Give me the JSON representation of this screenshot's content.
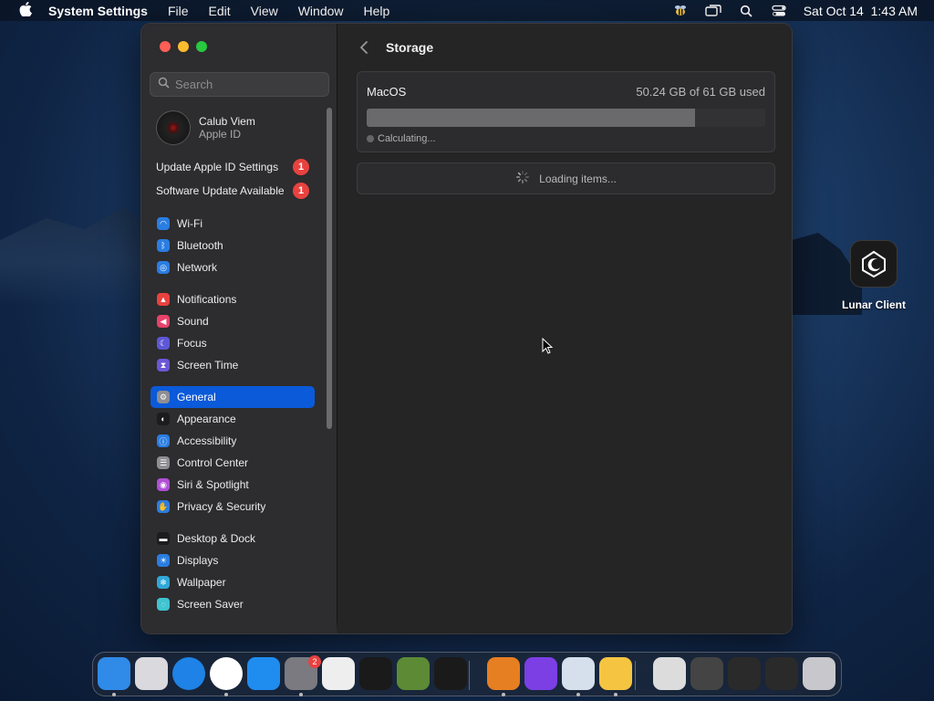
{
  "menubar": {
    "app_name": "System Settings",
    "menus": [
      "File",
      "Edit",
      "View",
      "Window",
      "Help"
    ],
    "clock": "Sat Oct 14  1:43 AM",
    "status_icons": [
      "bee-icon",
      "screen-mirror-icon",
      "spotlight-search-icon",
      "control-center-icon"
    ]
  },
  "window": {
    "search": {
      "placeholder": "Search",
      "value": ""
    },
    "account": {
      "name": "Calub Viem",
      "subtitle": "Apple ID"
    },
    "notices": [
      {
        "label": "Update Apple ID Settings",
        "badge": "1"
      },
      {
        "label": "Software Update Available",
        "badge": "1"
      }
    ],
    "sidebar_groups": [
      [
        {
          "label": "Wi-Fi",
          "icon": "wifi-icon",
          "color": "#2a7de1"
        },
        {
          "label": "Bluetooth",
          "icon": "bluetooth-icon",
          "color": "#2a7de1"
        },
        {
          "label": "Network",
          "icon": "globe-icon",
          "color": "#2a7de1"
        }
      ],
      [
        {
          "label": "Notifications",
          "icon": "bell-icon",
          "color": "#e8423f"
        },
        {
          "label": "Sound",
          "icon": "speaker-icon",
          "color": "#e8426a"
        },
        {
          "label": "Focus",
          "icon": "moon-icon",
          "color": "#5e57d6"
        },
        {
          "label": "Screen Time",
          "icon": "hourglass-icon",
          "color": "#6b57d6"
        }
      ],
      [
        {
          "label": "General",
          "icon": "gear-icon",
          "color": "#8e8e93",
          "selected": true
        },
        {
          "label": "Appearance",
          "icon": "appearance-icon",
          "color": "#1c1c1e"
        },
        {
          "label": "Accessibility",
          "icon": "accessibility-icon",
          "color": "#2a7de1"
        },
        {
          "label": "Control Center",
          "icon": "control-center-icon",
          "color": "#8e8e93"
        },
        {
          "label": "Siri & Spotlight",
          "icon": "siri-icon",
          "color": "#b04fd6"
        },
        {
          "label": "Privacy & Security",
          "icon": "hand-icon",
          "color": "#2a7de1"
        }
      ],
      [
        {
          "label": "Desktop & Dock",
          "icon": "dock-icon",
          "color": "#1c1c1e"
        },
        {
          "label": "Displays",
          "icon": "sun-icon",
          "color": "#2a7de1"
        },
        {
          "label": "Wallpaper",
          "icon": "wallpaper-icon",
          "color": "#2fa8d8"
        },
        {
          "label": "Screen Saver",
          "icon": "screensaver-icon",
          "color": "#3fc4d0"
        }
      ]
    ],
    "main": {
      "title": "Storage",
      "disk_name": "MacOS",
      "usage_text": "50.24 GB of 61 GB used",
      "usage_fraction": 0.8236,
      "status": "Calculating...",
      "loading_text": "Loading items..."
    }
  },
  "desktop": {
    "icon_label": "Lunar Client"
  },
  "dock": {
    "apps": [
      {
        "name": "finder-icon",
        "color": "#2f8ae8"
      },
      {
        "name": "launchpad-icon",
        "color": "#d9d9de"
      },
      {
        "name": "safari-icon",
        "color": "#1e82e6"
      },
      {
        "name": "chrome-icon",
        "color": "#ffffff"
      },
      {
        "name": "app-store-icon",
        "color": "#1f8cf0"
      },
      {
        "name": "system-settings-icon",
        "color": "#7a7a80",
        "badge": "2"
      },
      {
        "name": "script-editor-icon",
        "color": "#eeeeee"
      },
      {
        "name": "terminal-icon",
        "color": "#1a1a1a"
      },
      {
        "name": "minecraft-icon",
        "color": "#5c8a35"
      },
      {
        "name": "lunar-client-icon",
        "color": "#1a1a1a"
      },
      {
        "name": "downloads-icon",
        "color": "#e67e22"
      },
      {
        "name": "instruments-icon",
        "color": "#7b3fe4"
      },
      {
        "name": "settings-gear-icon",
        "color": "#d6e0ec"
      },
      {
        "name": "bee-app-icon",
        "color": "#f5c542"
      },
      {
        "name": "window-thumbnail-1",
        "color": "#dcdcdc"
      },
      {
        "name": "window-thumbnail-2",
        "color": "#444444"
      },
      {
        "name": "window-thumbnail-3",
        "color": "#2a2a2a"
      },
      {
        "name": "window-thumbnail-4",
        "color": "#2a2a2a"
      },
      {
        "name": "trash-icon",
        "color": "#c8c8cc"
      }
    ]
  }
}
